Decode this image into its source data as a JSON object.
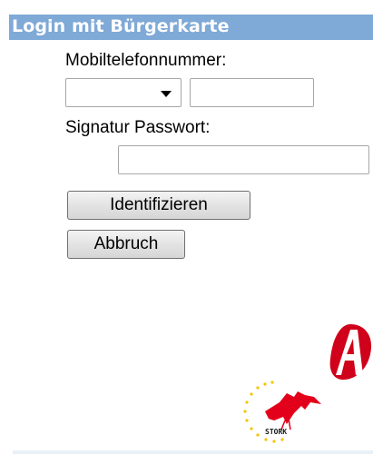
{
  "header": {
    "title": "Login mit Bürgerkarte"
  },
  "form": {
    "phone_label": "Mobiltelefonnummer:",
    "country_select": {
      "value": ""
    },
    "phone_input": {
      "value": "",
      "placeholder": ""
    },
    "password_label": "Signatur Passwort:",
    "password_input": {
      "value": "",
      "placeholder": ""
    }
  },
  "buttons": {
    "identify_label": "Identifizieren",
    "cancel_label": "Abbruch"
  },
  "logos": {
    "a_sign_text": "A",
    "stork_text": "STORK"
  },
  "colors": {
    "header_bg": "#7fa9d6",
    "a_logo_red": "#d0021b",
    "stork_red": "#e2001a",
    "stork_star_yellow": "#f5c400"
  }
}
